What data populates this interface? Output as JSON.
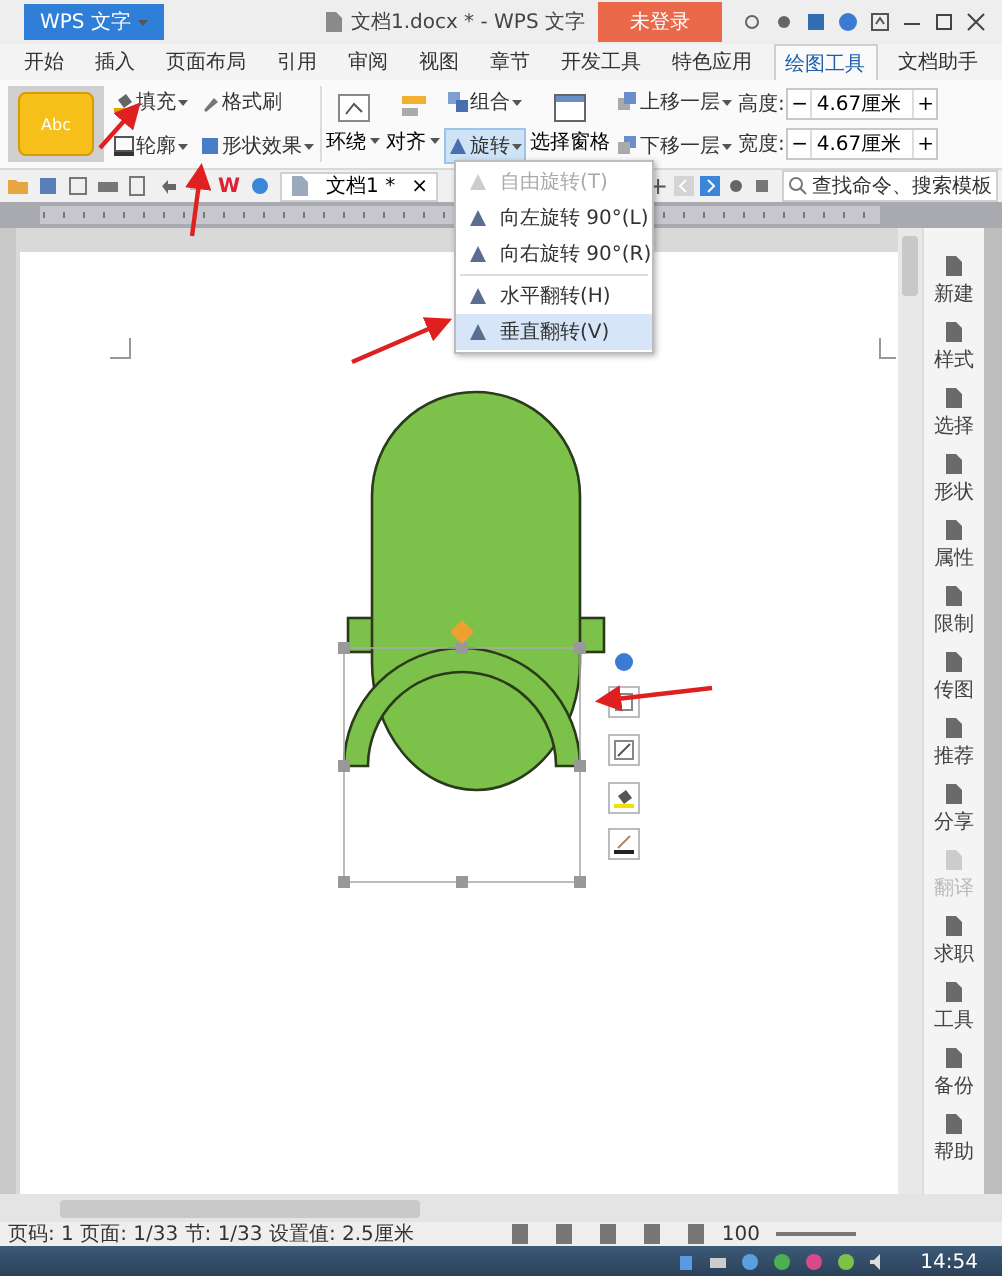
{
  "app_button": {
    "label": "WPS 文字"
  },
  "window": {
    "title": "文档1.docx * - WPS 文字",
    "login": "未登录"
  },
  "tabs": [
    {
      "label": "开始",
      "selected": false
    },
    {
      "label": "插入",
      "selected": false
    },
    {
      "label": "页面布局",
      "selected": false
    },
    {
      "label": "引用",
      "selected": false
    },
    {
      "label": "审阅",
      "selected": false
    },
    {
      "label": "视图",
      "selected": false
    },
    {
      "label": "章节",
      "selected": false
    },
    {
      "label": "开发工具",
      "selected": false
    },
    {
      "label": "特色应用",
      "selected": false
    },
    {
      "label": "绘图工具",
      "selected": true
    },
    {
      "label": "文档助手",
      "selected": false
    }
  ],
  "ribbon": {
    "style_sample": "Abc",
    "fill": "填充",
    "format_painter": "格式刷",
    "outline": "轮廓",
    "shape_effects": "形状效果",
    "wrap": "环绕",
    "align": "对齐",
    "group": "组合",
    "rotate": {
      "label": "旋转",
      "pressed": true
    },
    "selection_pane": "选择窗格",
    "bring_forward": "上移一层",
    "send_backward": "下移一层",
    "height": {
      "label": "高度:",
      "decrement": "−",
      "value": "4.67厘米",
      "increment": "+"
    },
    "width": {
      "label": "宽度:",
      "decrement": "−",
      "value": "4.67厘米",
      "increment": "+"
    }
  },
  "quick_bar": {
    "logo": "W",
    "doc_tab": {
      "label": "文档1 *",
      "close": "×"
    },
    "new_tab": "+",
    "search": "查找命令、搜索模板"
  },
  "rotate_menu": [
    {
      "label": "自由旋转(T)",
      "disabled": true,
      "selected": false,
      "separator_before": false
    },
    {
      "label": "向左旋转 90°(L)",
      "disabled": false,
      "selected": false,
      "separator_before": false
    },
    {
      "label": "向右旋转 90°(R)",
      "disabled": false,
      "selected": false,
      "separator_before": false
    },
    {
      "label": "水平翻转(H)",
      "disabled": false,
      "selected": false,
      "separator_before": true
    },
    {
      "label": "垂直翻转(V)",
      "disabled": false,
      "selected": true,
      "separator_before": false
    }
  ],
  "sidebar": [
    {
      "label": "新建",
      "disabled": false
    },
    {
      "label": "样式",
      "disabled": false
    },
    {
      "label": "选择",
      "disabled": false
    },
    {
      "label": "形状",
      "disabled": false
    },
    {
      "label": "属性",
      "disabled": false
    },
    {
      "label": "限制",
      "disabled": false
    },
    {
      "label": "传图",
      "disabled": false
    },
    {
      "label": "推荐",
      "disabled": false
    },
    {
      "label": "分享",
      "disabled": false
    },
    {
      "label": "翻译",
      "disabled": true
    },
    {
      "label": "求职",
      "disabled": false
    },
    {
      "label": "工具",
      "disabled": false
    },
    {
      "label": "备份",
      "disabled": false
    },
    {
      "label": "帮助",
      "disabled": false
    }
  ],
  "status_bar": {
    "text": "页码: 1  页面: 1/33  节: 1/33  设置值: 2.5厘米",
    "zoom": "100"
  },
  "taskbar": {
    "time": "14:54"
  }
}
